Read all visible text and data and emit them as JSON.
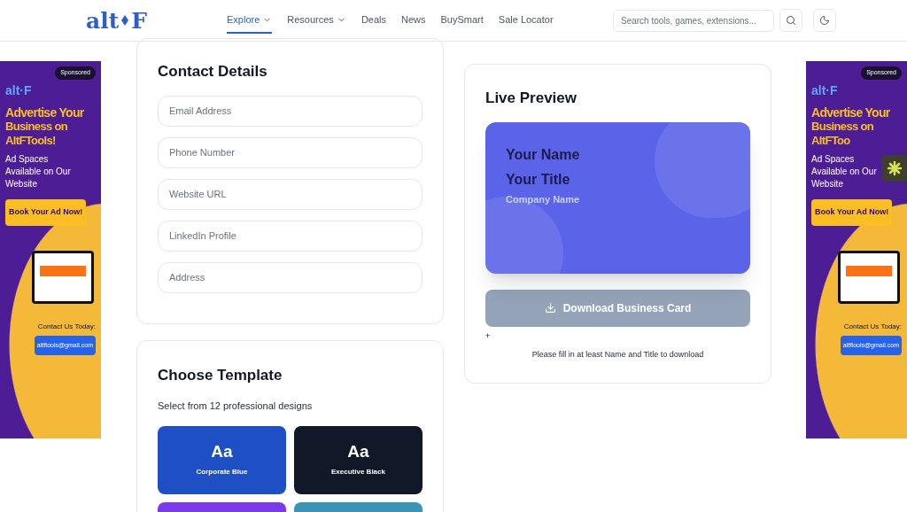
{
  "header": {
    "logo": {
      "left": "alt",
      "right": "F"
    },
    "nav": [
      {
        "label": "Explore",
        "selected": true,
        "dropdown": true
      },
      {
        "label": "Resources",
        "selected": false,
        "dropdown": true
      },
      {
        "label": "Deals",
        "selected": false,
        "dropdown": false
      },
      {
        "label": "News",
        "selected": false,
        "dropdown": false
      },
      {
        "label": "BuySmart",
        "selected": false,
        "dropdown": false
      },
      {
        "label": "Sale Locator",
        "selected": false,
        "dropdown": false
      }
    ],
    "search": {
      "placeholder": "Search tools, games, extensions..."
    }
  },
  "ads": [
    {
      "badge": "Sponsored",
      "logo": "alt·F",
      "headline_1": "Advertise Your",
      "headline_2": "Business on AltFTools!",
      "subline": "Ad Spaces Available on Our Website",
      "cta": "Book Your Ad Now!",
      "contact": "Contact Us Today:",
      "email": "altftools@gmail.com"
    },
    {
      "badge": "Sponsored",
      "logo": "alt·F",
      "headline_1": "Advertise Your",
      "headline_2": "Business on AltFToo",
      "subline": "Ad Spaces Available on Our Website",
      "cta": "Book Your Ad Now!",
      "contact": "Contact Us Today:",
      "email": "altftools@gmail.com"
    }
  ],
  "contact": {
    "title": "Contact Details",
    "fields": [
      {
        "placeholder": "Email Address"
      },
      {
        "placeholder": "Phone Number"
      },
      {
        "placeholder": "Website URL"
      },
      {
        "placeholder": "LinkedIn Profile"
      },
      {
        "placeholder": "Address"
      }
    ]
  },
  "templates": {
    "title": "Choose Template",
    "subtitle": "Select from 12 professional designs",
    "items": [
      {
        "sample": "Aa",
        "name": "Corporate Blue",
        "color": "#1e4fc4"
      },
      {
        "sample": "Aa",
        "name": "Executive Black",
        "color": "#111827"
      },
      {
        "color": "#7c3aed"
      },
      {
        "color": "#3b94b6"
      }
    ]
  },
  "preview": {
    "title": "Live Preview",
    "card": {
      "name": "Your Name",
      "job_title": "Your Title",
      "company": "Company Name"
    },
    "download": {
      "label": "Download Business Card",
      "disabled": true
    },
    "marker": "+",
    "hint": "Please fill in at least Name and Title to download"
  }
}
